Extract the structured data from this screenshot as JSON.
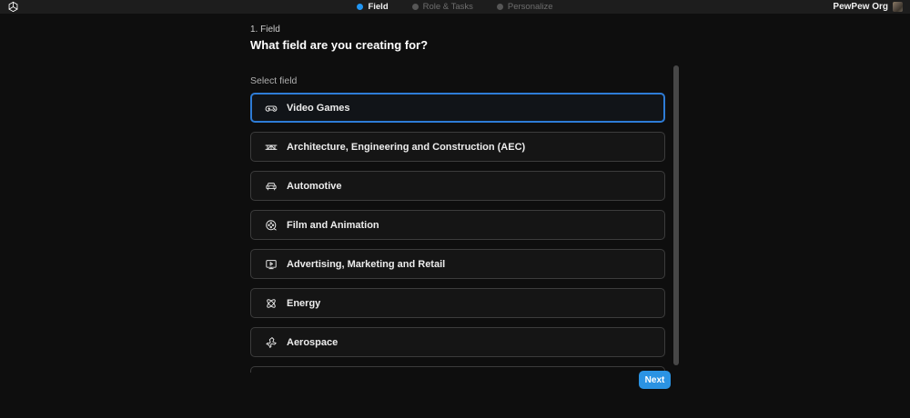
{
  "topbar": {
    "steps": [
      {
        "label": "Field",
        "active": true
      },
      {
        "label": "Role & Tasks",
        "active": false
      },
      {
        "label": "Personalize",
        "active": false
      }
    ],
    "org_name": "PewPew Org"
  },
  "header": {
    "step_label": "1. Field",
    "title": "What field are you creating for?"
  },
  "list": {
    "label": "Select field",
    "items": [
      {
        "label": "Video Games",
        "icon": "gamepad-icon",
        "selected": true
      },
      {
        "label": "Architecture, Engineering and Construction (AEC)",
        "icon": "bridge-icon",
        "selected": false
      },
      {
        "label": "Automotive",
        "icon": "car-icon",
        "selected": false
      },
      {
        "label": "Film and Animation",
        "icon": "film-reel-icon",
        "selected": false
      },
      {
        "label": "Advertising, Marketing and Retail",
        "icon": "screen-play-icon",
        "selected": false
      },
      {
        "label": "Energy",
        "icon": "atom-icon",
        "selected": false
      },
      {
        "label": "Aerospace",
        "icon": "plane-icon",
        "selected": false
      }
    ]
  },
  "footer": {
    "next_label": "Next"
  },
  "colors": {
    "accent": "#2196f3",
    "selected_border": "#2e7cd6",
    "topbar_bg": "#1d1d1d",
    "page_bg": "#0e0e0e",
    "card_bg": "#151515",
    "card_border": "#3c3c3c"
  }
}
